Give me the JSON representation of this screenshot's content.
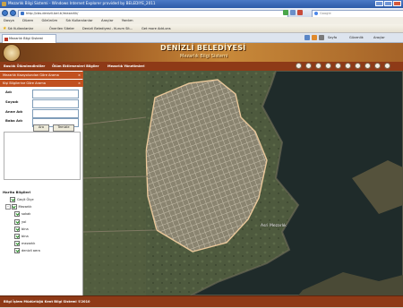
{
  "window": {
    "title": "Mezarlık Bilgi Sistemi - Windows Internet Explorer provided by BELEDIYE_2011"
  },
  "addressbar": {
    "url": "http://cbs.denizli.bel.tr/mezarlik/",
    "search_placeholder": "Google"
  },
  "menubar": {
    "items": [
      "Dosya",
      "Düzen",
      "Görünüm",
      "Sık Kullanılanlar",
      "Araçlar",
      "Yardım"
    ]
  },
  "favorites": {
    "label": "Sık Kullanılanlar",
    "items": [
      "Önerilen Siteler",
      "Denizli Belediyesi - Kurum Sit...",
      "Get more Add-ons"
    ]
  },
  "tabbar": {
    "active_tab": "Mezarlık Bilgi Sistemi",
    "commands": [
      "Sayfa",
      "Güvenlik",
      "Araçlar"
    ]
  },
  "header": {
    "title": "DENİZLİ BELEDİYESİ",
    "subtitle": "Mezarlık Bilgi Sistemi"
  },
  "sitenav": {
    "items": [
      "Basılık Ölümlendirdiler",
      "Ölüm Ektirmenleri Bilgiler",
      "Mezarlık Yönetimleri"
    ]
  },
  "search_panel": {
    "header1": "Mezarlık Kısayolundan Göre Arama",
    "header2": "Kişi Bilgilerine Göre Arama",
    "fields": [
      {
        "label": "Adı",
        "value": ""
      },
      {
        "label": "Soyadı",
        "value": ""
      },
      {
        "label": "Anne Adı",
        "value": ""
      },
      {
        "label": "Baba Adı",
        "value": ""
      }
    ],
    "search_button": "Ara",
    "clear_button": "Temizle"
  },
  "layers": {
    "title": "Harita Bilgileri",
    "items": [
      {
        "label": "Geçit Ölçe",
        "checked": true,
        "level": 1
      },
      {
        "label": "Mezarlık",
        "checked": true,
        "level": 0
      },
      {
        "label": "sokak",
        "checked": true,
        "level": 2
      },
      {
        "label": "yol",
        "checked": true,
        "level": 2
      },
      {
        "label": "bina",
        "checked": true,
        "level": 2
      },
      {
        "label": "bina",
        "checked": true,
        "level": 2
      },
      {
        "label": "mezarlık",
        "checked": true,
        "level": 2
      },
      {
        "label": "denizli aera",
        "checked": true,
        "level": 2
      }
    ]
  },
  "map": {
    "area_label": "Asri Mezarlık",
    "toolbar_tools": [
      "pan-icon",
      "zoom-in-icon",
      "zoom-out-icon",
      "full-extent-icon",
      "info-icon",
      "measure-icon",
      "print-icon",
      "back-icon",
      "forward-icon",
      "refresh-icon"
    ],
    "colors": {
      "water": "#1f2b2a",
      "boundary": "#e9c79a"
    }
  },
  "footer": {
    "text": "Bilgi İşlem Müdürlüğü Kent Bilgi Sistemi ©2010"
  }
}
